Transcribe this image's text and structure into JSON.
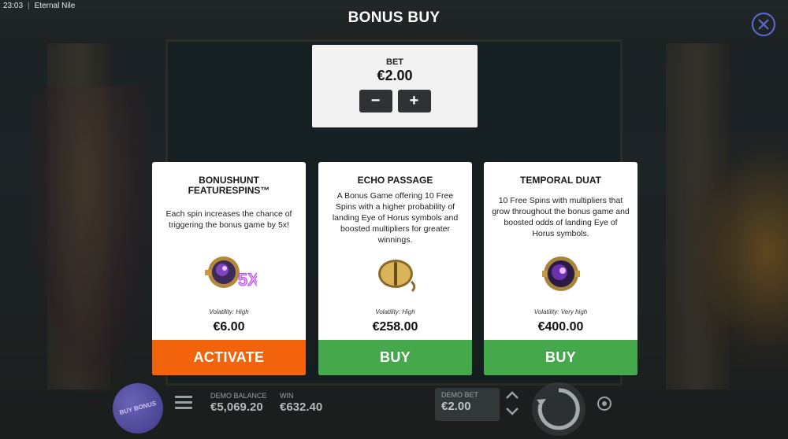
{
  "status": {
    "time": "23:03",
    "app_name": "Eternal Nile"
  },
  "header": {
    "title": "BONUS BUY"
  },
  "bet": {
    "label": "BET",
    "value": "€2.00",
    "minus": "−",
    "plus": "+"
  },
  "cards": [
    {
      "name": "BONUSHUNT FEATURESPINS™",
      "description": "Each spin increases the chance of triggering the bonus game by 5x!",
      "volatility": "Volatility: High",
      "price": "€6.00",
      "action": "ACTIVATE",
      "icon": "eye-of-horus-5x-icon",
      "icon_badge": "5X"
    },
    {
      "name": "ECHO PASSAGE",
      "description": "A Bonus Game offering 10 Free Spins with a higher probability of landing Eye of Horus symbols and boosted multipliers for greater winnings.",
      "volatility": "Volatility: High",
      "price": "€258.00",
      "action": "BUY",
      "icon": "golden-eye-icon"
    },
    {
      "name": "TEMPORAL DUAT",
      "description": "10 Free Spins with multipliers that grow throughout the bonus game and boosted odds of landing Eye of Horus symbols.",
      "volatility": "Volatility: Very high",
      "price": "€400.00",
      "action": "BUY",
      "icon": "galaxy-orb-icon"
    }
  ],
  "footer": {
    "buy_bonus": "BUY BONUS",
    "balance_label": "DEMO BALANCE",
    "balance_value": "€5,069.20",
    "win_label": "WIN",
    "win_value": "€632.40",
    "demo_bet_label": "DEMO BET",
    "demo_bet_value": "€2.00"
  },
  "colors": {
    "activate": "#f2630c",
    "buy": "#45a84a",
    "close_ring": "#5a6bd8",
    "buy_bonus": "#4a4596"
  }
}
